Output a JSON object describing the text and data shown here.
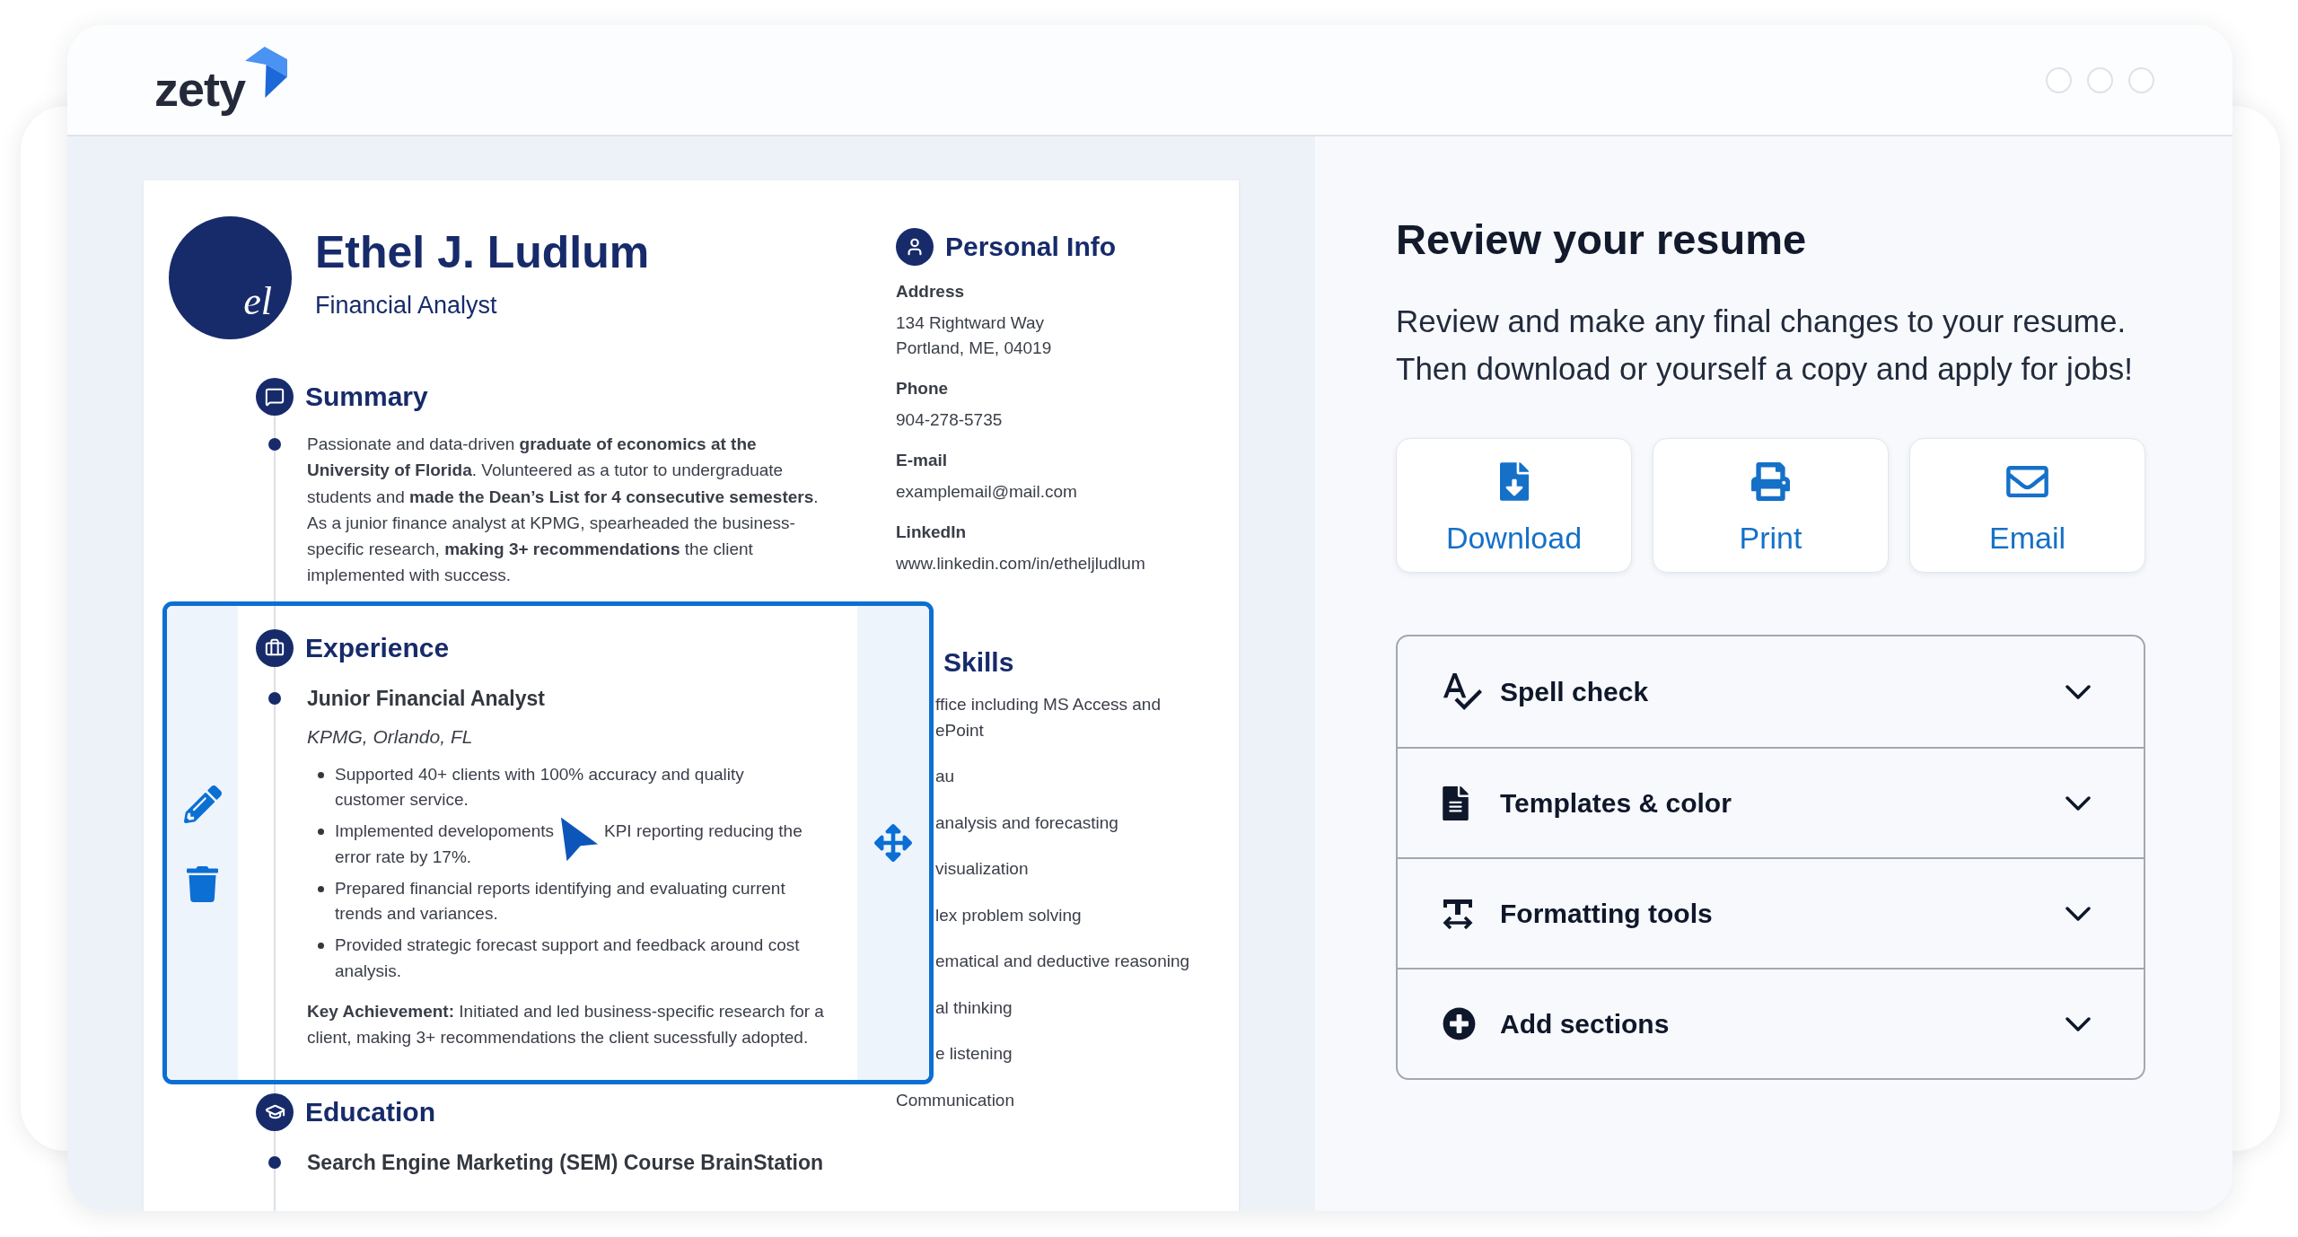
{
  "header": {
    "logo": "zety"
  },
  "resume": {
    "avatar_initials": "el",
    "name": "Ethel J. Ludlum",
    "title": "Financial Analyst",
    "summary": {
      "heading": "Summary",
      "text": "Passionate and data-driven **graduate of economics at the University of Florida**. Volunteered as a tutor to undergraduate students and **made the Dean’s List for 4 consecutive semesters**. As a junior finance analyst at KPMG, spearheaded the business-specific research, **making 3+ recommendations** the client implemented with success."
    },
    "experience": {
      "heading": "Experience",
      "selected": true,
      "entries": [
        {
          "job_title": "Junior Financial Analyst",
          "company": "KPMG, Orlando, FL",
          "bullets": [
            {
              "parts": [
                "Supported 40+ clients with 100% accuracy and quality customer service."
              ]
            },
            {
              "parts": [
                "Implemented developoments",
                "KPI reporting reducing the",
                "error rate by 17%."
              ]
            },
            {
              "parts": [
                "Prepared financial reports identifying and evaluating current trends and variances."
              ]
            },
            {
              "parts": [
                "Provided strategic forecast support and feedback around cost analysis."
              ]
            }
          ],
          "key_achievement": "**Key Achievement:** Initiated and led business-specific research for a client, making 3+ recommendations the client sucessfully adopted."
        }
      ]
    },
    "education": {
      "heading": "Education",
      "entries": [
        "Search Engine Marketing (SEM) Course BrainStation"
      ]
    },
    "personal_info": {
      "heading": "Personal Info",
      "fields": [
        {
          "label": "Address",
          "value_lines": [
            "134 Rightward Way",
            "Portland, ME, 04019"
          ]
        },
        {
          "label": "Phone",
          "value_lines": [
            "904-278-5735"
          ]
        },
        {
          "label": "E-mail",
          "value_lines": [
            "examplemail@mail.com"
          ]
        },
        {
          "label": "LinkedIn",
          "value_lines": [
            "www.linkedin.com/in/etheljludlum"
          ]
        }
      ]
    },
    "skills": {
      "heading": "Skills",
      "partly_covered_items": [
        "ffice including MS Access and ePoint",
        "au",
        "analysis and forecasting",
        "visualization",
        "lex problem solving",
        "ematical and deductive reasoning",
        "al thinking",
        "e listening"
      ],
      "items": [
        "Communication"
      ]
    }
  },
  "review": {
    "title": "Review your resume",
    "description_lines": [
      "Review and make any final changes to your resume.",
      "Then download or yourself a copy and apply for jobs!"
    ],
    "actions": [
      {
        "kind": "download",
        "label": "Download"
      },
      {
        "kind": "print",
        "label": "Print"
      },
      {
        "kind": "email",
        "label": "Email"
      }
    ],
    "tools": [
      {
        "kind": "spellcheck",
        "label": "Spell check",
        "expanded": false
      },
      {
        "kind": "templates",
        "label": "Templates & color",
        "expanded": false
      },
      {
        "kind": "formatting",
        "label": "Formatting tools",
        "expanded": false
      },
      {
        "kind": "sections",
        "label": "Add sections",
        "expanded": false
      }
    ]
  }
}
